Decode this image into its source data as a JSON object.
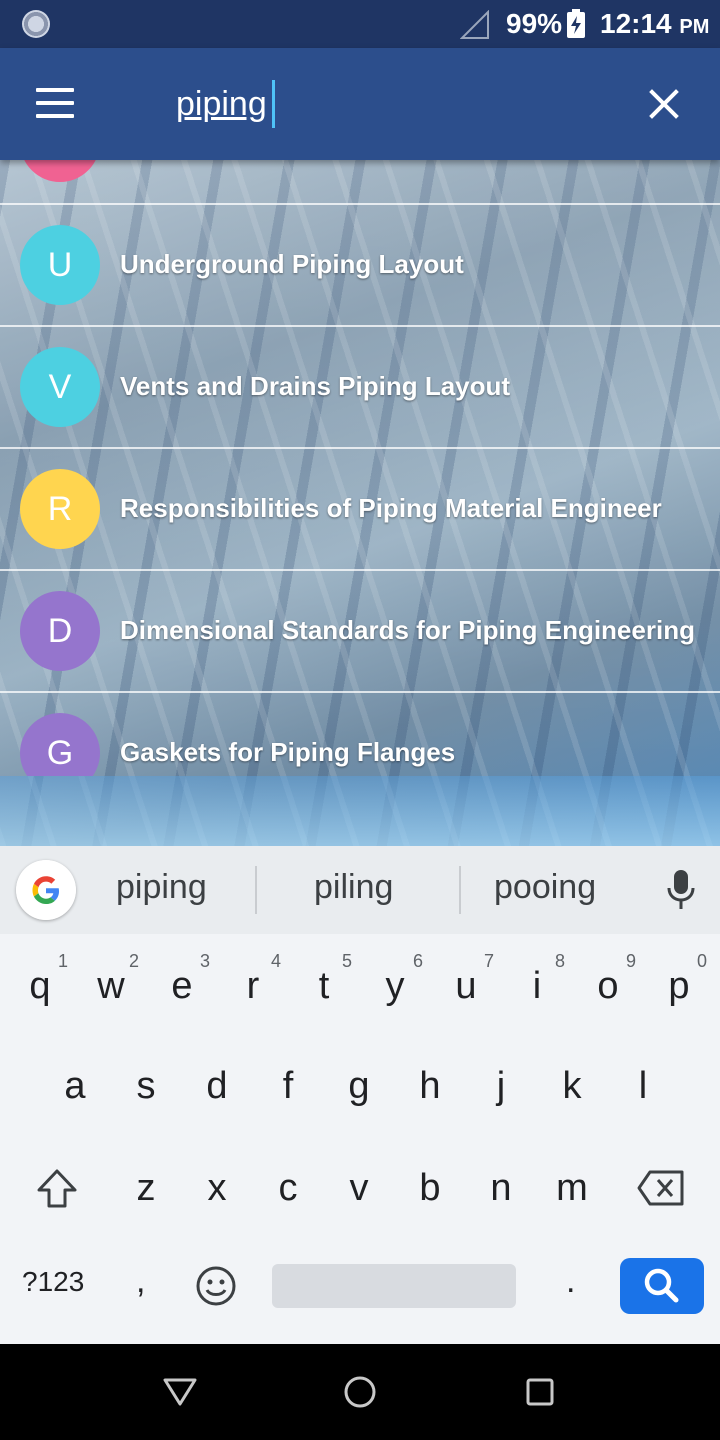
{
  "status_bar": {
    "battery": "99%",
    "time": "12:14",
    "ampm": "PM"
  },
  "search": {
    "value": "piping"
  },
  "results": [
    {
      "letter": "U",
      "color": "#4dd0e1",
      "title": "Underground Piping Layout"
    },
    {
      "letter": "V",
      "color": "#4dd0e1",
      "title": "Vents and Drains Piping Layout"
    },
    {
      "letter": "R",
      "color": "#ffd54f",
      "title": "Responsibilities of Piping Material Engineer"
    },
    {
      "letter": "D",
      "color": "#9575cd",
      "title": "Dimensional Standards for Piping Engineering"
    },
    {
      "letter": "G",
      "color": "#9575cd",
      "title": "Gaskets for Piping Flanges"
    }
  ],
  "partial_item_color": "#f06292",
  "keyboard": {
    "suggestions": [
      "piping",
      "piling",
      "pooing"
    ],
    "row1": [
      {
        "k": "q",
        "n": "1"
      },
      {
        "k": "w",
        "n": "2"
      },
      {
        "k": "e",
        "n": "3"
      },
      {
        "k": "r",
        "n": "4"
      },
      {
        "k": "t",
        "n": "5"
      },
      {
        "k": "y",
        "n": "6"
      },
      {
        "k": "u",
        "n": "7"
      },
      {
        "k": "i",
        "n": "8"
      },
      {
        "k": "o",
        "n": "9"
      },
      {
        "k": "p",
        "n": "0"
      }
    ],
    "row2": [
      "a",
      "s",
      "d",
      "f",
      "g",
      "h",
      "j",
      "k",
      "l"
    ],
    "row3": [
      "z",
      "x",
      "c",
      "v",
      "b",
      "n",
      "m"
    ],
    "numbers_label": "?123",
    "comma": ",",
    "period": ".",
    "search_color": "#1a73e8"
  },
  "icons": {
    "status_left": "sync-circle-icon",
    "signal": "signal-icon",
    "battery": "battery-charging-icon",
    "menu": "menu-icon",
    "close": "close-icon",
    "google": "google-g-icon",
    "mic": "mic-icon",
    "shift": "shift-icon",
    "backspace": "backspace-icon",
    "emoji": "emoji-icon",
    "search": "search-icon",
    "nav_back": "back-icon",
    "nav_home": "home-icon",
    "nav_recent": "recent-apps-icon"
  }
}
